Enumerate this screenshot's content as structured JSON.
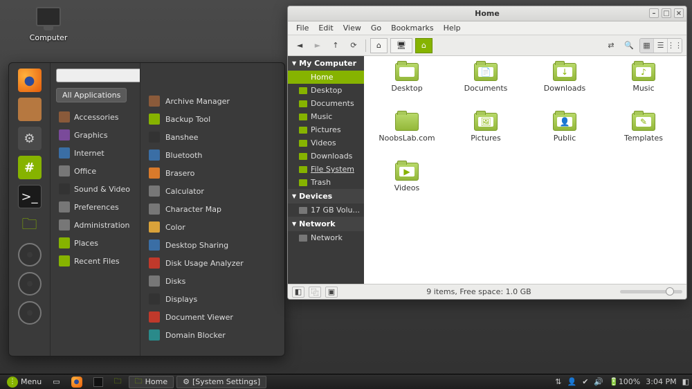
{
  "desktop": {
    "computer_label": "Computer"
  },
  "appmenu": {
    "search_placeholder": "",
    "all_apps_chip": "All Applications",
    "categories": [
      {
        "label": "Accessories",
        "cls": "ic-brown"
      },
      {
        "label": "Graphics",
        "cls": "ic-purple"
      },
      {
        "label": "Internet",
        "cls": "ic-blue"
      },
      {
        "label": "Office",
        "cls": "ic-grey"
      },
      {
        "label": "Sound & Video",
        "cls": "ic-dark"
      },
      {
        "label": "Preferences",
        "cls": "ic-grey"
      },
      {
        "label": "Administration",
        "cls": "ic-grey"
      },
      {
        "label": "Places",
        "cls": "ic-green"
      },
      {
        "label": "Recent Files",
        "cls": "ic-green"
      }
    ],
    "apps": [
      {
        "label": "Archive Manager",
        "cls": "ic-brown"
      },
      {
        "label": "Backup Tool",
        "cls": "ic-green"
      },
      {
        "label": "Banshee",
        "cls": "ic-dark"
      },
      {
        "label": "Bluetooth",
        "cls": "ic-blue"
      },
      {
        "label": "Brasero",
        "cls": "ic-orange"
      },
      {
        "label": "Calculator",
        "cls": "ic-grey"
      },
      {
        "label": "Character Map",
        "cls": "ic-grey"
      },
      {
        "label": "Color",
        "cls": "ic-yellow"
      },
      {
        "label": "Desktop Sharing",
        "cls": "ic-blue"
      },
      {
        "label": "Disk Usage Analyzer",
        "cls": "ic-red"
      },
      {
        "label": "Disks",
        "cls": "ic-grey"
      },
      {
        "label": "Displays",
        "cls": "ic-dark"
      },
      {
        "label": "Document Viewer",
        "cls": "ic-red"
      },
      {
        "label": "Domain Blocker",
        "cls": "ic-teal"
      }
    ],
    "favorites": [
      {
        "name": "firefox",
        "cls": "ff",
        "glyph": "●"
      },
      {
        "name": "package",
        "cls": "fbox",
        "glyph": ""
      },
      {
        "name": "settings",
        "cls": "fset",
        "glyph": "⚙"
      },
      {
        "name": "hash",
        "cls": "fhash",
        "glyph": "#"
      },
      {
        "name": "terminal",
        "cls": "fterm",
        "glyph": ">_"
      },
      {
        "name": "files",
        "cls": "ffolder",
        "glyph": "🗀"
      },
      {
        "name": "disc1",
        "cls": "fdisc",
        "glyph": ""
      },
      {
        "name": "disc2",
        "cls": "fdisc",
        "glyph": ""
      },
      {
        "name": "disc3",
        "cls": "fdisc",
        "glyph": ""
      }
    ]
  },
  "fm": {
    "title": "Home",
    "menus": [
      "File",
      "Edit",
      "View",
      "Go",
      "Bookmarks",
      "Help"
    ],
    "path_home_glyph": "⌂",
    "sidebar": {
      "my_computer": "My Computer",
      "devices": "Devices",
      "network_head": "Network",
      "places": [
        {
          "label": "Home",
          "sel": true
        },
        {
          "label": "Desktop"
        },
        {
          "label": "Documents"
        },
        {
          "label": "Music"
        },
        {
          "label": "Pictures"
        },
        {
          "label": "Videos"
        },
        {
          "label": "Downloads"
        },
        {
          "label": "File System",
          "underline": true
        },
        {
          "label": "Trash"
        }
      ],
      "device": "17 GB Volu...",
      "network": "Network"
    },
    "items": [
      {
        "label": "Desktop",
        "glyph": ""
      },
      {
        "label": "Documents",
        "glyph": "📄"
      },
      {
        "label": "Downloads",
        "glyph": "↓"
      },
      {
        "label": "Music",
        "glyph": "♪"
      },
      {
        "label": "NoobsLab.com",
        "glyph": "",
        "plain": true
      },
      {
        "label": "Pictures",
        "glyph": "🖼"
      },
      {
        "label": "Public",
        "glyph": "👤"
      },
      {
        "label": "Templates",
        "glyph": "✎"
      },
      {
        "label": "Videos",
        "glyph": "▶"
      }
    ],
    "status": "9 items, Free space: 1.0 GB"
  },
  "panel": {
    "menu": "Menu",
    "task_home": "Home",
    "task_settings": "[System Settings]",
    "battery": "100%",
    "clock": "3:04 PM"
  }
}
